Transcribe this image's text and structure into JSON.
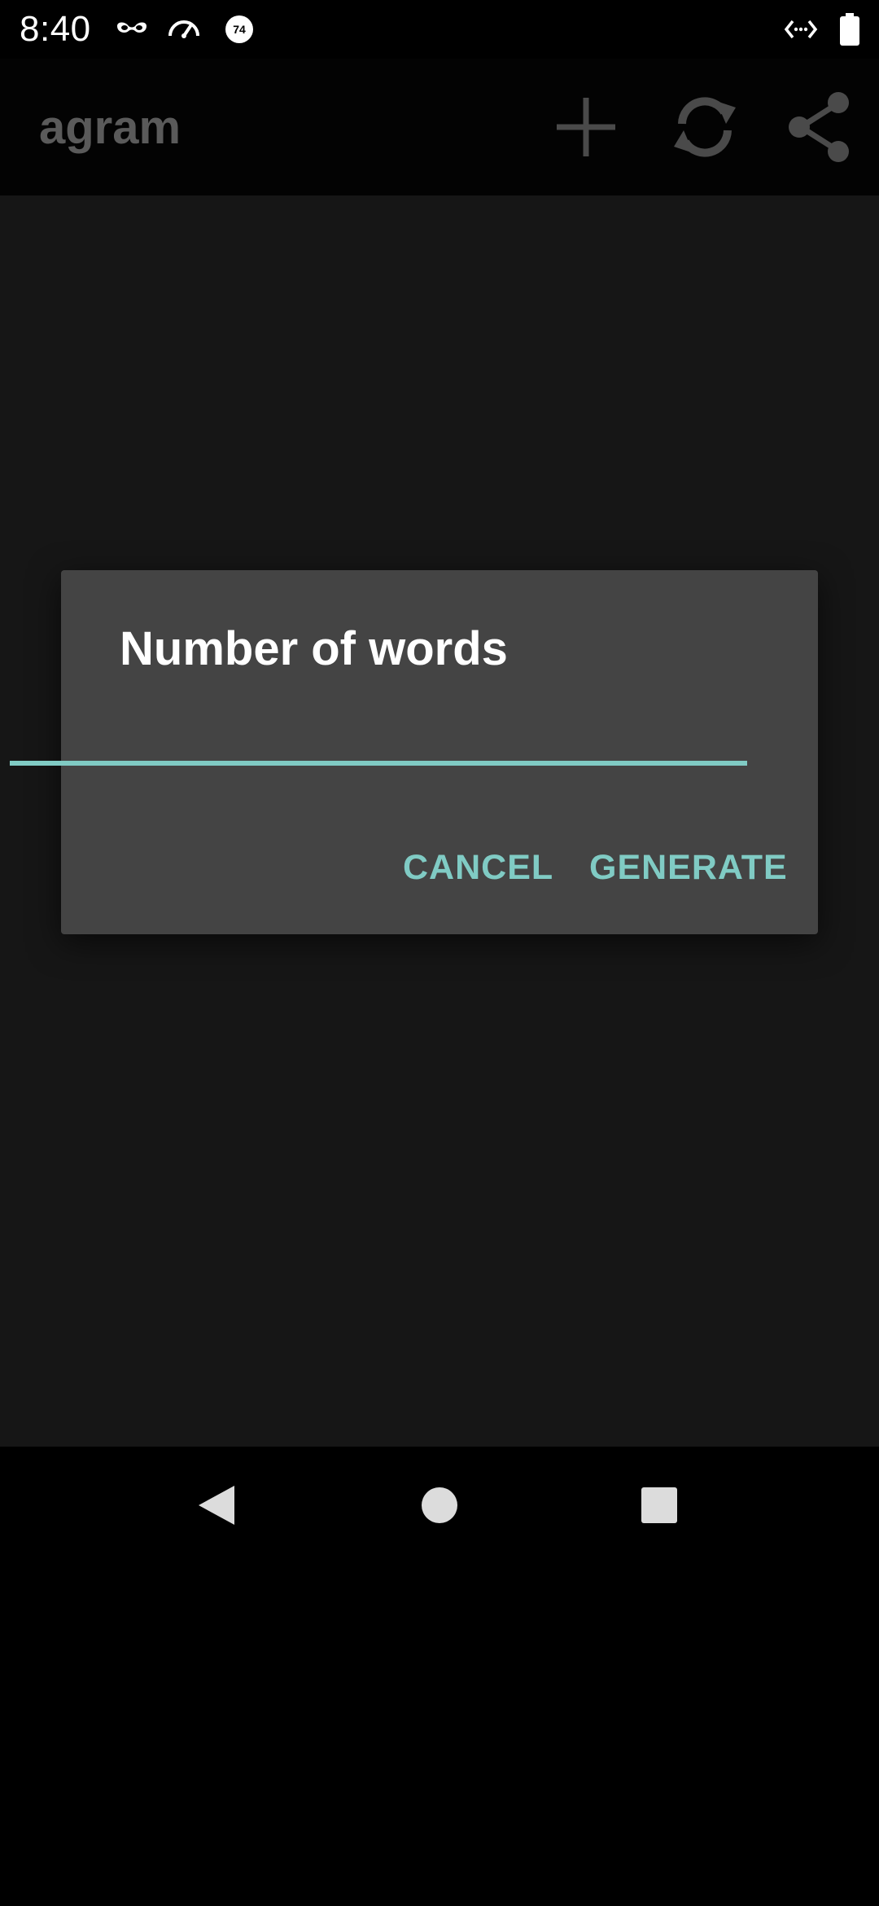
{
  "status_bar": {
    "time": "8:40",
    "icons": [
      "incognito-icon",
      "speedometer-icon",
      "badge-74-icon",
      "code-icon",
      "battery-icon"
    ],
    "badge_number": "74"
  },
  "app_bar": {
    "title": "agram",
    "actions": [
      "add-icon",
      "refresh-icon",
      "share-icon"
    ]
  },
  "dialog": {
    "title": "Number of words",
    "input_value": "",
    "input_placeholder": "",
    "cancel_label": "CANCEL",
    "generate_label": "GENERATE"
  },
  "nav_bar": {
    "buttons": [
      "back-icon",
      "home-icon",
      "recents-icon"
    ]
  },
  "colors": {
    "accent": "#80cbc4",
    "dialog_bg": "#444444",
    "content_bg": "#161616",
    "title_text": "#5a5a5a"
  }
}
